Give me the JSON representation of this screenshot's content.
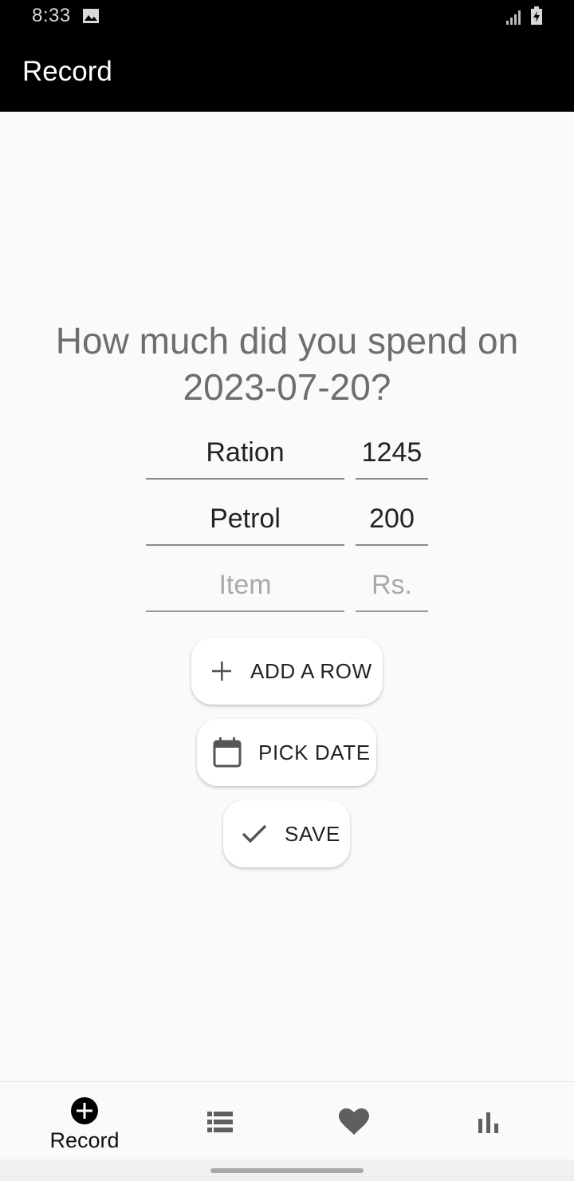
{
  "status_bar": {
    "time": "8:33"
  },
  "app_bar": {
    "title": "Record"
  },
  "question": {
    "line1": "How much did you spend on",
    "line2": "2023-07-20?"
  },
  "rows": [
    {
      "item": "Ration",
      "amount": "1245"
    },
    {
      "item": "Petrol",
      "amount": "200"
    },
    {
      "item_placeholder": "Item",
      "amount_placeholder": "Rs."
    }
  ],
  "buttons": {
    "add_row": "ADD A ROW",
    "pick_date": "PICK DATE",
    "save": "SAVE"
  },
  "bottom_nav": {
    "record_label": "Record",
    "active": "record"
  },
  "colors": {
    "app_bar": "#000000",
    "background": "#fafafa",
    "question_text": "#6e6e6e",
    "icon": "#555555"
  }
}
